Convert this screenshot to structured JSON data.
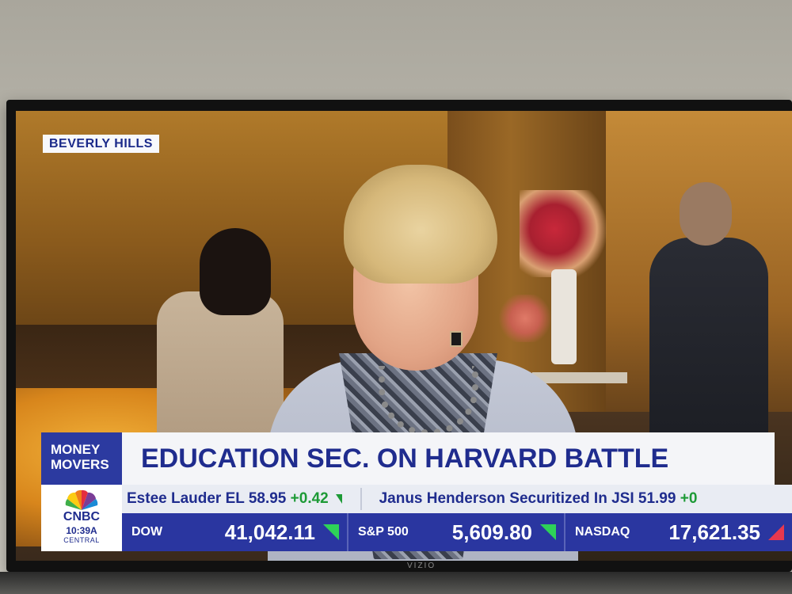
{
  "broadcast": {
    "location": "BEVERLY HILLS",
    "show_name_line1": "MONEY",
    "show_name_line2": "MOVERS",
    "headline": "EDUCATION SEC. ON HARVARD BATTLE",
    "network": "CNBC",
    "time": "10:39A",
    "timezone": "CENTRAL"
  },
  "ticker": [
    {
      "text": "Estee Lauder EL 58.95",
      "change": "+0.42",
      "direction": "up"
    },
    {
      "text": "Janus Henderson Securitized In JSI 51.99",
      "change": "+0",
      "direction": "up"
    }
  ],
  "indices": [
    {
      "name": "DOW",
      "value": "41,042.11",
      "direction": "up"
    },
    {
      "name": "S&P 500",
      "value": "5,609.80",
      "direction": "up"
    },
    {
      "name": "NASDAQ",
      "value": "17,621.35",
      "direction": "down"
    }
  ],
  "tv": {
    "brand": "VIZIO"
  },
  "colors": {
    "network_blue": "#2a36a0",
    "headline_text": "#1f2c8e",
    "up_green": "#2ed158",
    "down_red": "#e8384e"
  }
}
